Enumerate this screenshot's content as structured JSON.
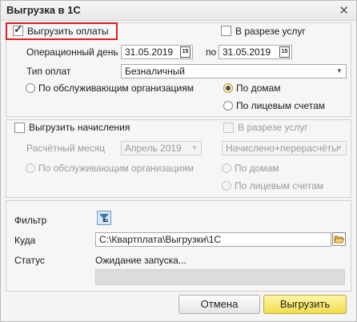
{
  "window": {
    "title": "Выгрузка в 1С",
    "close_icon": "close-icon"
  },
  "payments": {
    "export_label": "Выгрузить оплаты",
    "export_checked": true,
    "by_services_label": "В разрезе услуг",
    "op_day_label": "Операционный день",
    "date_from": "31.05.2019",
    "to_label": "по",
    "date_to": "31.05.2019",
    "cal_glyph": "15",
    "pay_type_label": "Тип оплат",
    "pay_type_value": "Безналичный",
    "radio_orgs": "По обслуживающим организациям",
    "radio_houses": "По домам",
    "radio_accounts": "По лицевым счетам",
    "selected": "houses"
  },
  "accruals": {
    "export_label": "Выгрузить начисления",
    "by_services_label": "В разрезе услуг",
    "month_label": "Расчётный месяц",
    "month_value": "Апрель 2019",
    "calc_value": "Начислено+перерасчёты",
    "radio_orgs": "По обслуживающим организациям",
    "radio_houses": "По домам",
    "radio_accounts": "По лицевым счетам"
  },
  "bottom": {
    "filter_label": "Фильтр",
    "filter_icon": "filter-icon",
    "dest_label": "Куда",
    "dest_path": "C:\\Квартплата\\Выгрузки\\1С",
    "folder_icon": "folder-icon",
    "status_label": "Статус",
    "status_text": "Ожидание запуска...",
    "progress": 0
  },
  "buttons": {
    "cancel": "Отмена",
    "ok": "Выгрузить"
  }
}
